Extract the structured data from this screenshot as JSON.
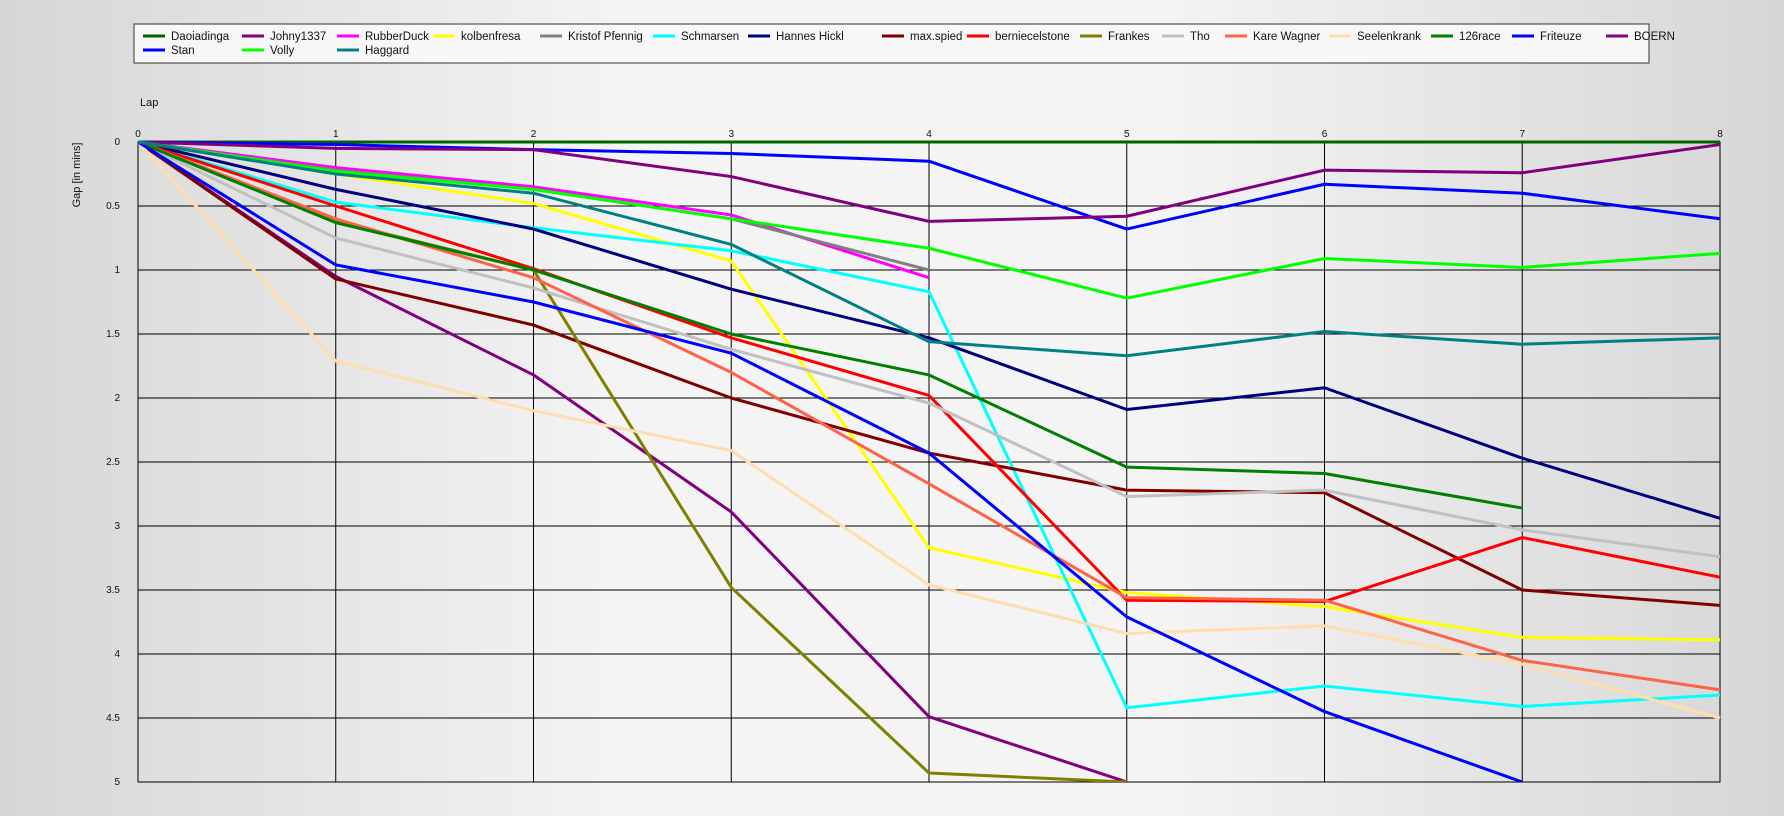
{
  "chart_data": {
    "type": "line",
    "xlabel": "Lap",
    "ylabel": "Gap [in mins]",
    "x": [
      0,
      1,
      2,
      3,
      4,
      5,
      6,
      7,
      8
    ],
    "x_ticks": [
      "0",
      "1",
      "2",
      "3",
      "4",
      "5",
      "6",
      "7",
      "8"
    ],
    "y_ticks": [
      "0",
      "0.5",
      "1",
      "1.5",
      "2",
      "2.5",
      "3",
      "3.5",
      "4",
      "4.5",
      "5"
    ],
    "xlim": [
      0,
      8
    ],
    "ylim": [
      0,
      5
    ],
    "y_inverted": true,
    "grid": true,
    "legend_position": "top",
    "series": [
      {
        "name": "Daoiadinga",
        "color": "#006400",
        "values": [
          0,
          0,
          0,
          0,
          0,
          0,
          0,
          0,
          0
        ]
      },
      {
        "name": "Johny1337",
        "color": "#800080",
        "values": [
          0,
          1.05,
          1.82,
          2.89,
          4.49,
          5.0,
          null,
          null,
          null
        ]
      },
      {
        "name": "RubberDuck",
        "color": "#ff00ff",
        "values": [
          0,
          0.2,
          0.35,
          0.57,
          1.06,
          null,
          null,
          null,
          null
        ]
      },
      {
        "name": "kolbenfresa",
        "color": "#ffff00",
        "values": [
          0,
          0.25,
          0.48,
          0.93,
          3.17,
          3.52,
          3.63,
          3.87,
          3.89
        ]
      },
      {
        "name": "Kristof Pfennig",
        "color": "#808080",
        "values": [
          0,
          0.22,
          0.37,
          0.6,
          1.0,
          null,
          null,
          null,
          null
        ]
      },
      {
        "name": "Schmarsen",
        "color": "#00ffff",
        "values": [
          0,
          0.47,
          0.67,
          0.85,
          1.17,
          4.42,
          4.25,
          4.41,
          4.32
        ]
      },
      {
        "name": "Hannes Hickl",
        "color": "#000080",
        "values": [
          0,
          0.37,
          0.68,
          1.15,
          1.53,
          2.09,
          1.92,
          2.47,
          2.94
        ]
      },
      {
        "name": "max.spied",
        "color": "#800000",
        "values": [
          0,
          1.07,
          1.43,
          2.0,
          2.43,
          2.72,
          2.74,
          3.5,
          3.62
        ]
      },
      {
        "name": "berniecelstone",
        "color": "#ff0000",
        "values": [
          0,
          0.5,
          0.99,
          1.53,
          1.98,
          3.58,
          3.59,
          3.09,
          3.4
        ]
      },
      {
        "name": "Frankes",
        "color": "#808000",
        "values": [
          0,
          0.62,
          1.0,
          3.48,
          4.93,
          5.0,
          null,
          null,
          null
        ]
      },
      {
        "name": "Tho",
        "color": "#c0c0c0",
        "values": [
          0,
          0.75,
          1.14,
          1.62,
          2.04,
          2.77,
          2.72,
          3.03,
          3.24
        ]
      },
      {
        "name": "Kare Wagner",
        "color": "#ff6347",
        "values": [
          0,
          0.6,
          1.06,
          1.8,
          2.67,
          3.56,
          3.58,
          4.05,
          4.28
        ]
      },
      {
        "name": "Seelenkrank",
        "color": "#ffdead",
        "values": [
          0,
          1.71,
          2.1,
          2.41,
          3.46,
          3.84,
          3.78,
          4.08,
          4.5
        ]
      },
      {
        "name": "126race",
        "color": "#008000",
        "values": [
          0,
          0.63,
          1.0,
          1.5,
          1.82,
          2.54,
          2.59,
          2.86,
          null
        ]
      },
      {
        "name": "Friteuze",
        "color": "#0000ff",
        "values": [
          0,
          0.02,
          0.06,
          0.09,
          0.15,
          0.68,
          0.33,
          0.4,
          0.6
        ]
      },
      {
        "name": "BOERN",
        "color": "#800080",
        "values": [
          0,
          0.05,
          0.06,
          0.27,
          0.62,
          0.58,
          0.22,
          0.24,
          0.02
        ]
      },
      {
        "name": "Stan",
        "color": "#0000ff",
        "values": [
          0,
          0.96,
          1.25,
          1.65,
          2.43,
          3.71,
          4.45,
          5.0,
          null
        ]
      },
      {
        "name": "Volly",
        "color": "#00ff00",
        "values": [
          0,
          0.23,
          0.37,
          0.6,
          0.83,
          1.22,
          0.91,
          0.98,
          0.87
        ]
      },
      {
        "name": "Haggard",
        "color": "#008080",
        "values": [
          0,
          0.25,
          0.4,
          0.8,
          1.56,
          1.67,
          1.48,
          1.58,
          1.53
        ]
      }
    ]
  }
}
